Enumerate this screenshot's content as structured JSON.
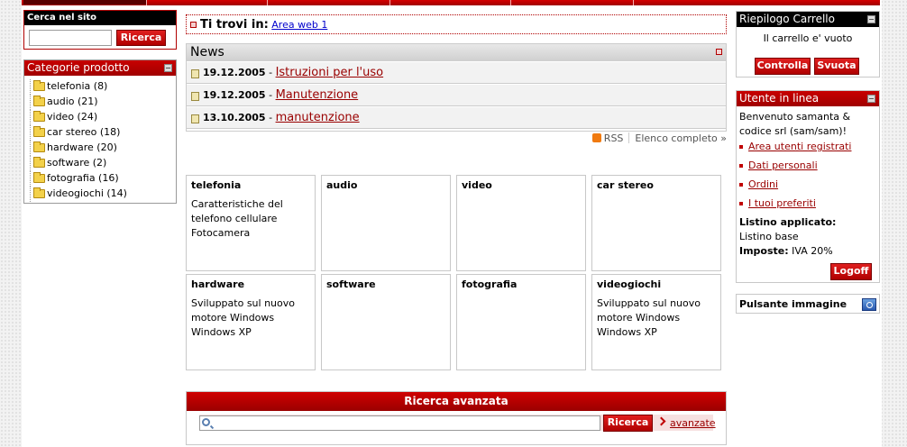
{
  "search": {
    "title": "Cerca nel sito",
    "placeholder": "",
    "button": "Ricerca"
  },
  "categories": {
    "title": "Categorie prodotto",
    "items": [
      {
        "label": "telefonia (8)"
      },
      {
        "label": "audio (21)"
      },
      {
        "label": "video (24)"
      },
      {
        "label": "car stereo (18)"
      },
      {
        "label": "hardware (20)"
      },
      {
        "label": "software (2)"
      },
      {
        "label": "fotografia (16)"
      },
      {
        "label": "videogiochi (14)"
      }
    ]
  },
  "breadcrumb": {
    "label": "Ti trovi in:",
    "link": "Area web 1"
  },
  "news": {
    "title": "News",
    "items": [
      {
        "date": "19.12.2005",
        "title": "Istruzioni per l'uso"
      },
      {
        "date": "19.12.2005",
        "title": "Manutenzione"
      },
      {
        "date": "13.10.2005",
        "title": "manutenzione"
      }
    ],
    "rss": "RSS",
    "all": "Elenco completo »"
  },
  "tiles": [
    {
      "name": "telefonia",
      "desc": "Caratteristiche del telefono cellulare Fotocamera"
    },
    {
      "name": "audio",
      "desc": ""
    },
    {
      "name": "video",
      "desc": ""
    },
    {
      "name": "car stereo",
      "desc": ""
    },
    {
      "name": "hardware",
      "desc": "Sviluppato sul nuovo motore Windows Windows XP"
    },
    {
      "name": "software",
      "desc": ""
    },
    {
      "name": "fotografia",
      "desc": ""
    },
    {
      "name": "videogiochi",
      "desc": "Sviluppato sul nuovo motore Windows Windows XP"
    }
  ],
  "advanced_search": {
    "title": "Ricerca avanzata",
    "button": "Ricerca",
    "link": "avanzate"
  },
  "cart": {
    "title": "Riepilogo Carrello",
    "empty": "Il carrello e' vuoto",
    "check": "Controlla",
    "empty_button": "Svuota"
  },
  "user": {
    "title": "Utente in linea",
    "welcome": "Benvenuto samanta & codice srl (sam/sam)!",
    "links": [
      "Area utenti registrati",
      "Dati personali",
      "Ordini",
      "I tuoi preferiti"
    ],
    "pricelist_label": "Listino applicato:",
    "pricelist_value": "Listino base",
    "tax_label": "Imposte:",
    "tax_value": "IVA 20%",
    "logoff": "Logoff"
  },
  "image_button": {
    "label": "Pulsante immagine"
  },
  "colors": {
    "accent": "#c00000",
    "dark_accent": "#9a0000",
    "header_black": "#000000"
  }
}
